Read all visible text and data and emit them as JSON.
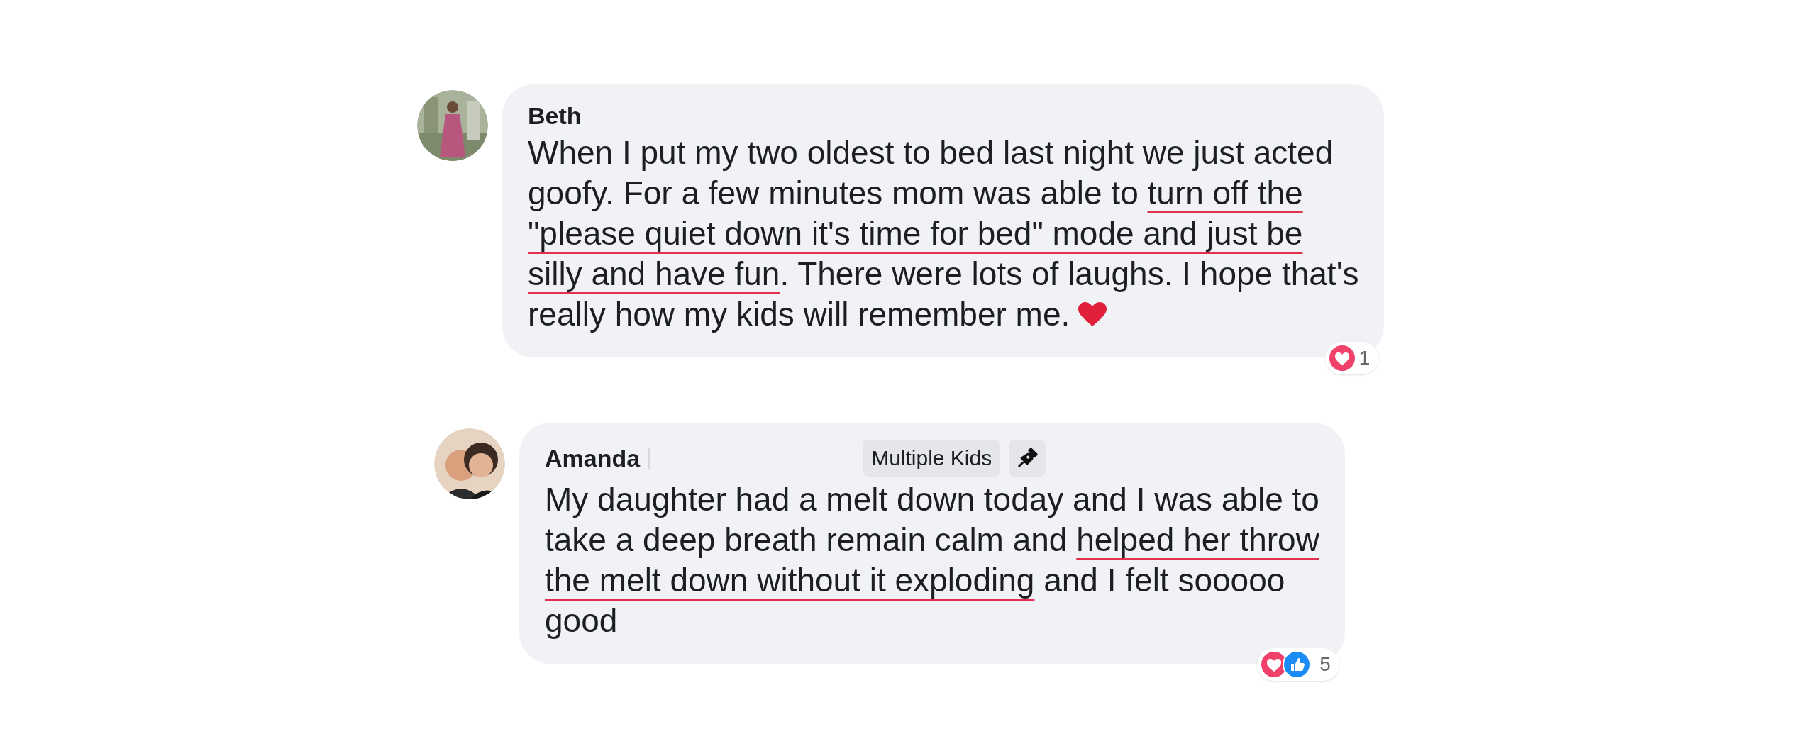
{
  "comments": [
    {
      "author": "Beth",
      "lines": [
        [
          {
            "text": "When I put my two oldest to bed last night we just acted",
            "underlined": false
          }
        ],
        [
          {
            "text": "goofy. For a few minutes mom was able to ",
            "underlined": false
          },
          {
            "text": "turn off the",
            "underlined": true
          }
        ],
        [
          {
            "text": "\"please quiet down it's time for bed\" mode and just be",
            "underlined": true
          }
        ],
        [
          {
            "text": "silly and have fun",
            "underlined": true
          },
          {
            "text": ". There were lots of laughs. I hope that's",
            "underlined": false
          }
        ],
        [
          {
            "text": "really how my kids will remember me.",
            "underlined": false
          }
        ]
      ],
      "ends_with_heart": true,
      "reactions": [
        {
          "kind": "love"
        }
      ],
      "reaction_count": "1"
    },
    {
      "author": "Amanda",
      "badge": "Multiple Kids",
      "lines": [
        [
          {
            "text": "My daughter had a melt down today and I was able to",
            "underlined": false
          }
        ],
        [
          {
            "text": "take a deep breath remain calm and ",
            "underlined": false
          },
          {
            "text": "helped her throw",
            "underlined": true
          }
        ],
        [
          {
            "text": "the melt down without it exploding",
            "underlined": true
          },
          {
            "text": " and I felt sooooo",
            "underlined": false
          }
        ],
        [
          {
            "text": "good",
            "underlined": false
          }
        ]
      ],
      "ends_with_heart": false,
      "reactions": [
        {
          "kind": "love"
        },
        {
          "kind": "like"
        }
      ],
      "reaction_count": "5"
    }
  ]
}
